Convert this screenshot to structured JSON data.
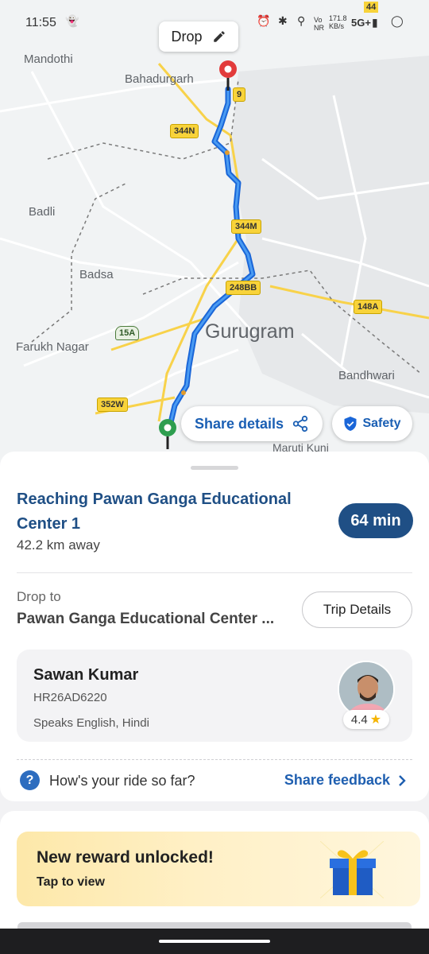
{
  "status_bar": {
    "time": "11:55",
    "network_speed": "171.8\nKB/s",
    "network_type": "5G+",
    "badge": "44"
  },
  "map": {
    "drop_chip_label": "Drop",
    "labels": {
      "mandothi": "Mandothi",
      "bahadurgarh": "Bahadurgarh",
      "badli": "Badli",
      "badsa": "Badsa",
      "gurugram": "Gurugram",
      "farukh_nagar": "Farukh Nagar",
      "bandhwari": "Bandhwari",
      "maruti_kunj": "Maruti Kunj"
    },
    "shields": {
      "nh9": "9",
      "nh344n": "344N",
      "nh344m": "344M",
      "nh248bb": "248BB",
      "nh148a": "148A",
      "sh15a": "15A",
      "nh352w": "352W"
    },
    "share_details_label": "Share details",
    "safety_label": "Safety"
  },
  "trip": {
    "title": "Reaching Pawan Ganga Educational Center 1",
    "distance": "42.2 km away",
    "eta": "64 min",
    "drop_label": "Drop to",
    "drop_address": "Pawan Ganga Educational Center ...",
    "trip_details_label": "Trip Details"
  },
  "driver": {
    "name": "Sawan Kumar",
    "vehicle": "HR26AD6220",
    "languages": "Speaks English, Hindi",
    "rating": "4.4"
  },
  "feedback": {
    "question": "How's your ride so far?",
    "action": "Share feedback"
  },
  "reward": {
    "title": "New reward unlocked!",
    "subtitle": "Tap to view"
  },
  "colors": {
    "primary": "#1f4f85",
    "link": "#1a5fb4",
    "route": "#3b82e0",
    "reward_bg": "#fde8a9"
  }
}
